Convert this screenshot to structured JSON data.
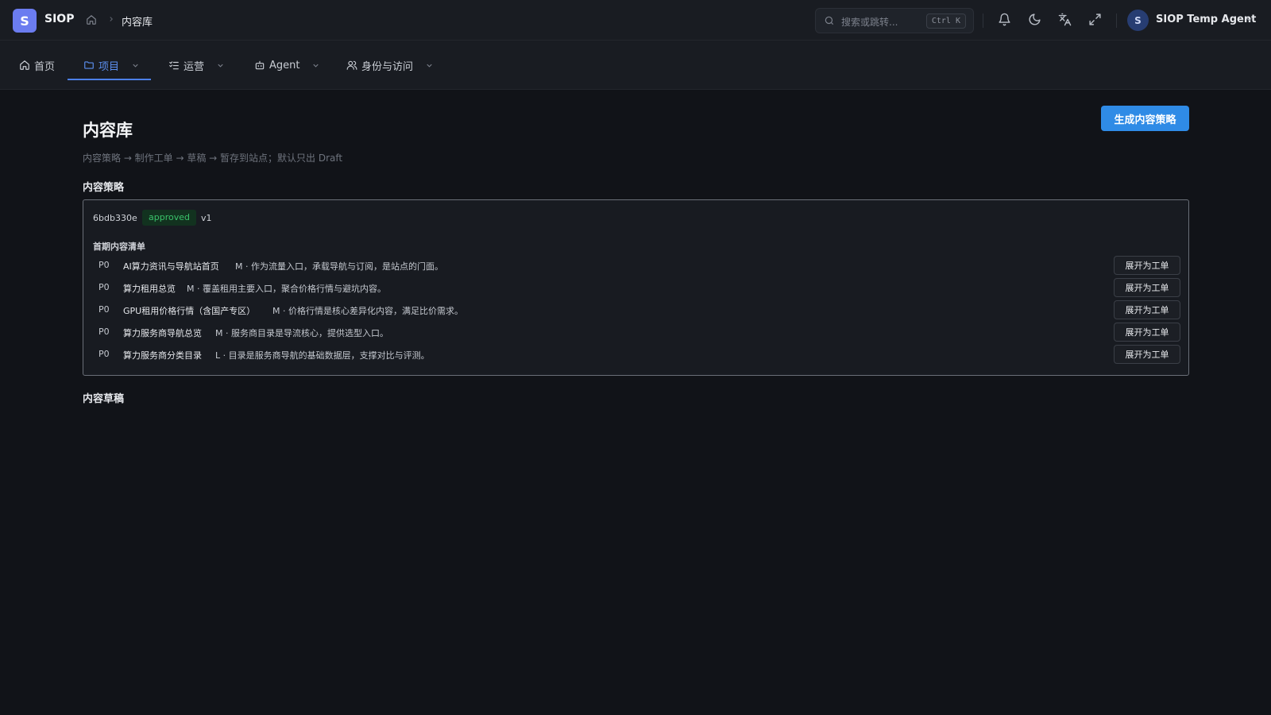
{
  "app": {
    "logo_letter": "S",
    "title": "SIOP"
  },
  "breadcrumb": {
    "current": "内容库"
  },
  "search": {
    "placeholder": "搜索或跳转...",
    "shortcut": "Ctrl K"
  },
  "user": {
    "avatar_letter": "S",
    "name": "SIOP Temp Agent"
  },
  "nav": {
    "items": [
      {
        "label": "首页",
        "icon": "home-icon"
      },
      {
        "label": "项目",
        "icon": "folder-icon",
        "active": true
      },
      {
        "label": "运营",
        "icon": "list-check-icon"
      },
      {
        "label": "Agent",
        "icon": "robot-icon"
      },
      {
        "label": "身份与访问",
        "icon": "users-icon"
      }
    ]
  },
  "page": {
    "title": "内容库",
    "subtitle": "内容策略 → 制作工单 → 草稿 → 暂存到站点；默认只出 Draft",
    "generate_button": "生成内容策略",
    "strategy_section": "内容策略",
    "drafts_section": "内容草稿"
  },
  "strategy": {
    "id": "6bdb330e",
    "status": "approved",
    "version": "v1",
    "list_title": "首期内容清单",
    "expand_label": "展开为工单",
    "items": [
      {
        "priority": "P0",
        "title": "AI算力资讯与导航站首页",
        "description": "M · 作为流量入口，承载导航与订阅，是站点的门面。"
      },
      {
        "priority": "P0",
        "title": "算力租用总览",
        "description": "M · 覆盖租用主要入口，聚合价格行情与避坑内容。"
      },
      {
        "priority": "P0",
        "title": "GPU租用价格行情（含国产专区）",
        "description": "M · 价格行情是核心差异化内容，满足比价需求。"
      },
      {
        "priority": "P0",
        "title": "算力服务商导航总览",
        "description": "M · 服务商目录是导流核心，提供选型入口。"
      },
      {
        "priority": "P0",
        "title": "算力服务商分类目录",
        "description": "L · 目录是服务商导航的基础数据层，支撑对比与评测。"
      }
    ]
  },
  "colors": {
    "accent": "#2f8be6",
    "nav_active": "#5c8ff0",
    "badge_green": "#3ac26a",
    "logo": "#6b7cf0"
  }
}
